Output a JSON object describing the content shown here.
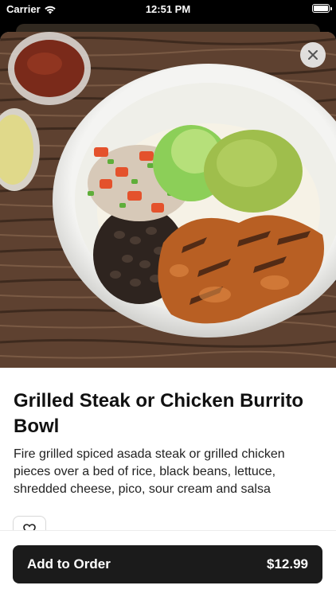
{
  "status_bar": {
    "carrier": "Carrier",
    "time": "12:51 PM"
  },
  "item": {
    "title": "Grilled Steak or Chicken Burrito Bowl",
    "description": "Fire grilled spiced asada steak or grilled chicken pieces over a bed of rice, black beans, lettuce, shredded cheese, pico, sour cream and salsa"
  },
  "order": {
    "label": "Add to Order",
    "price": "$12.99"
  },
  "icons": {
    "close": "close-icon",
    "favorite": "heart-icon",
    "wifi": "wifi-icon",
    "battery": "battery-icon"
  }
}
